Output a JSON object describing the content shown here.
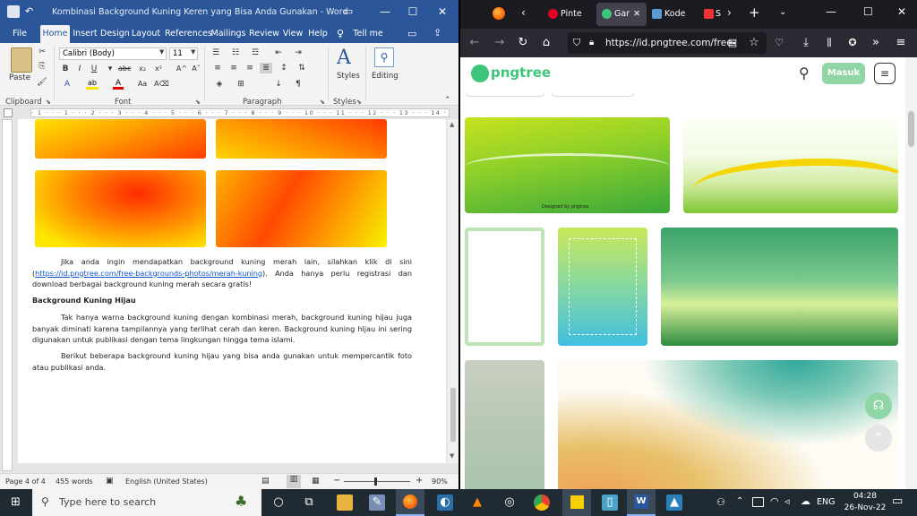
{
  "word": {
    "title": "Kombinasi Background Kuning Keren yang Bisa Anda Gunakan  -  Word",
    "tabs": [
      "File",
      "Home",
      "Insert",
      "Design",
      "Layout",
      "References",
      "Mailings",
      "Review",
      "View",
      "Help"
    ],
    "tell_me": "Tell me",
    "font_name": "Calibri (Body)",
    "font_size": "11",
    "paste_label": "Paste",
    "styles_label": "Styles",
    "editing_label": "Editing",
    "groups": [
      "Clipboard",
      "Font",
      "Paragraph",
      "Styles"
    ],
    "ruler_text": "· 1 · · · 1 · · · 2 · · · 3 · · · 4 · · · 5 · · · 6 · · · 7 · · · 8 · · · 9 · · · 10 · · · 11 · · · 12 · · · 13 · · · 14 · · · 15 · · · 16 · · · 17 · · · 18",
    "doc": {
      "p1_before": "Jika anda ingin mendapatkan background kuning merah lain, silahkan klik di sini (",
      "p1_link": "https://id.pngtree.com/free-backgrounds-photos/merah-kuning",
      "p1_after": "). Anda hanya perlu registrasi dan download berbagai background kuning merah secara gratis!",
      "heading": "Background Kuning Hijau",
      "p2": "Tak hanya warna background kuning dengan kombinasi merah, background kuning hijau juga banyak diminati karena tampilannya yang terlihat cerah dan keren. Background kuning hijau ini sering digunakan untuk publikasi dengan tema lingkungan hingga tema islami.",
      "p3": "Berikut beberapa background kuning hijau yang bisa anda gunakan untuk mempercantik foto atau publikasi anda."
    },
    "status": {
      "page": "Page 4 of 4",
      "words": "455 words",
      "language": "English (United States)",
      "zoom": "90%"
    }
  },
  "firefox": {
    "tabs": [
      {
        "label": "Pinte"
      },
      {
        "label": "Gar"
      },
      {
        "label": "Kode"
      },
      {
        "label": "S"
      }
    ],
    "url": "https://id.pngtree.com/free-",
    "brand": "pngtree",
    "login_label": "Masuk",
    "thumb_caption": "Designed by pngtree"
  },
  "taskbar": {
    "search_placeholder": "Type here to search",
    "lang": "ENG",
    "time": "04:28",
    "date": "26-Nov-22"
  },
  "colors": {
    "word_blue": "#2b579a",
    "pngtree_green": "#3ec57a",
    "masuk_green": "#8fd5a6",
    "link_blue": "#1155cc"
  }
}
